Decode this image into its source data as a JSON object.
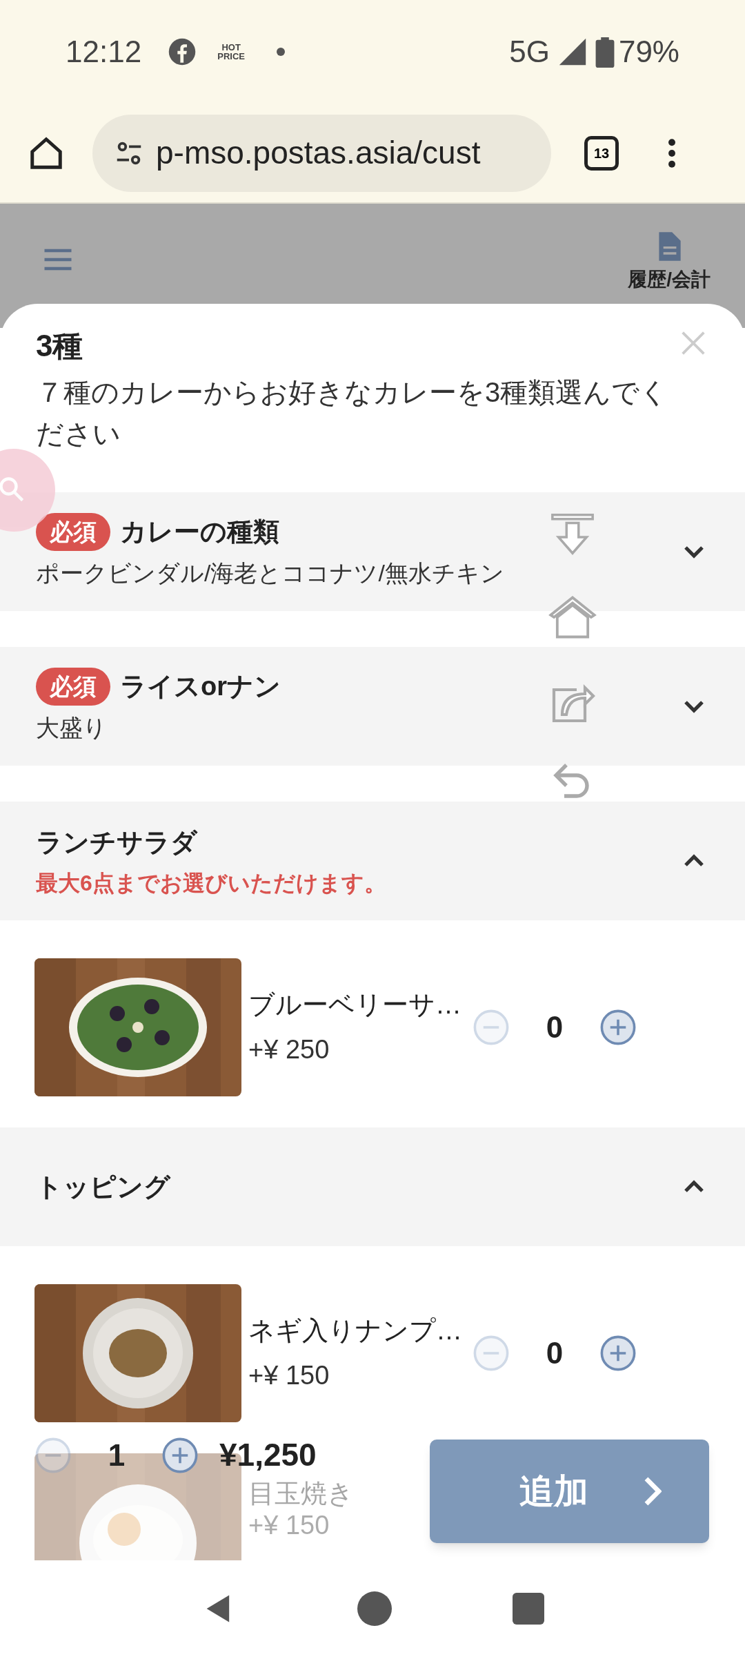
{
  "status_bar": {
    "time": "12:12",
    "notification_text": "HOT PRICE",
    "network": "5G",
    "battery": "79%"
  },
  "browser": {
    "url": "p-mso.postas.asia/cust",
    "tab_count": "13"
  },
  "header": {
    "history_label": "履歴/会計"
  },
  "sheet": {
    "title": "3種",
    "description": "７種のカレーからお好きなカレーを3種類選んでください"
  },
  "sections": [
    {
      "title": "カレーの種類",
      "badge": "必須",
      "summary": "ポークビンダル/海老とココナツ/無水チキン",
      "expanded": false
    },
    {
      "title": "ライスorナン",
      "badge": "必須",
      "summary": "大盛り",
      "expanded": false
    },
    {
      "title": "ランチサラダ",
      "note": "最大6点までお選びいただけます。",
      "expanded": true,
      "items": [
        {
          "kind": "salad",
          "name": "ブルーベリーサ…",
          "price": "+¥ 250",
          "quantity": "0",
          "faded": false
        }
      ]
    },
    {
      "title": "トッピング",
      "expanded": true,
      "items": [
        {
          "kind": "beans",
          "name": "ネギ入りナンプ…",
          "price": "+¥ 150",
          "quantity": "0",
          "faded": false
        },
        {
          "kind": "egg",
          "name": "目玉焼き",
          "price": "+¥ 150",
          "faded": true
        }
      ]
    }
  ],
  "footer": {
    "quantity": "1",
    "total": "¥1,250",
    "add_label": "追加"
  }
}
